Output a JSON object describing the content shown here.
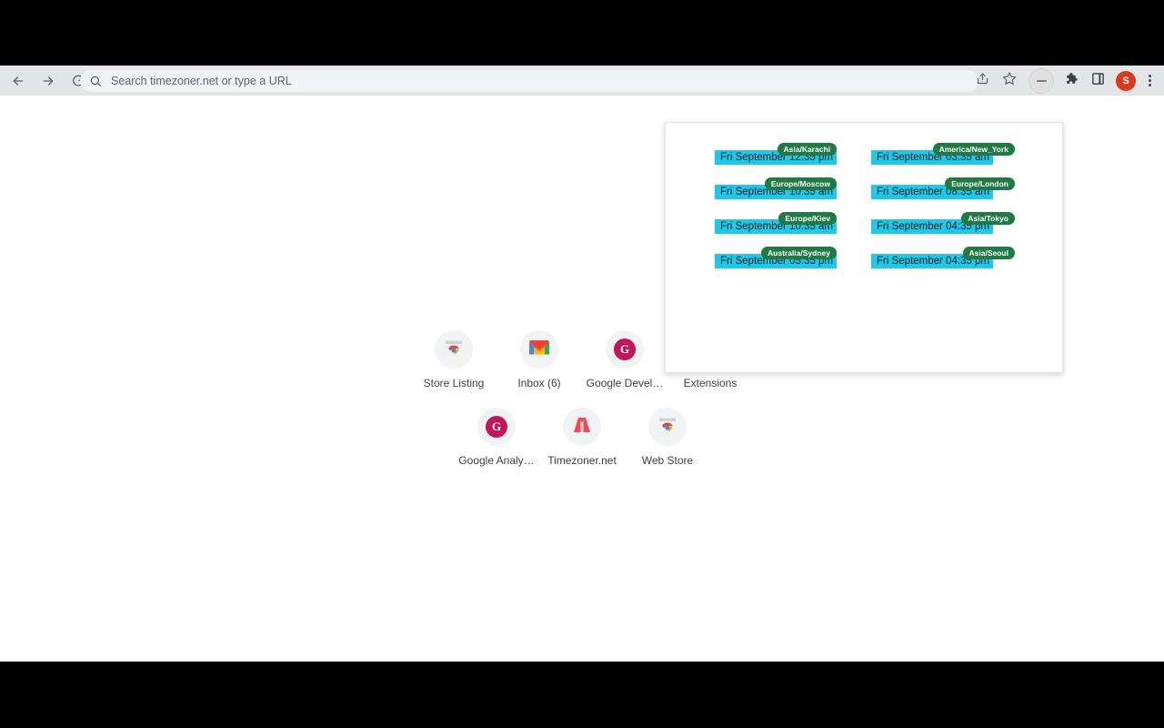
{
  "browser": {
    "nav": {
      "back_icon": "arrow-left-icon",
      "forward_icon": "arrow-right-icon",
      "reload_icon": "reload-icon"
    },
    "omnibox": {
      "placeholder": "Search timezoner.net or type a URL",
      "value": "",
      "search_icon": "search-icon"
    },
    "toolbar_right": {
      "share_icon": "share-icon",
      "bookmark_icon": "star-icon",
      "minimize_icon": "minimize-pill-icon",
      "extensions_icon": "puzzle-icon",
      "side_panel_icon": "side-panel-icon",
      "avatar_label": "S",
      "menu_icon": "three-dots-icon"
    }
  },
  "newtab": {
    "shortcuts": [
      {
        "label": "Store Listing",
        "icon": "chrome-web-store-icon"
      },
      {
        "label": "Inbox (6)",
        "icon": "gmail-icon"
      },
      {
        "label": "Google Devel…",
        "icon": "google-g-pink-icon"
      },
      {
        "label": "Extensions",
        "icon": "chrome-web-store-icon"
      },
      {
        "label": "Google Analy…",
        "icon": "google-g-pink-icon"
      },
      {
        "label": "Timezoner.net",
        "icon": "timezoner-logo-icon"
      },
      {
        "label": "Web Store",
        "icon": "chrome-web-store-icon"
      }
    ]
  },
  "popup": {
    "colors": {
      "time_bar": "#1ec8eb",
      "badge": "#1f7a43",
      "background": "#ffffff"
    },
    "timezones": [
      {
        "zone": "Asia/Karachi",
        "time": "Fri September 12:35 pm"
      },
      {
        "zone": "America/New_York",
        "time": "Fri September 03:35 am"
      },
      {
        "zone": "Europe/Moscow",
        "time": "Fri September 10:35 am"
      },
      {
        "zone": "Europe/London",
        "time": "Fri September 08:35 am"
      },
      {
        "zone": "Europe/Kiev",
        "time": "Fri September 10:35 am"
      },
      {
        "zone": "Asia/Tokyo",
        "time": "Fri September 04:35 pm"
      },
      {
        "zone": "Australia/Sydney",
        "time": "Fri September 05:35 pm"
      },
      {
        "zone": "Asia/Seoul",
        "time": "Fri September 04:35 pm"
      }
    ]
  }
}
